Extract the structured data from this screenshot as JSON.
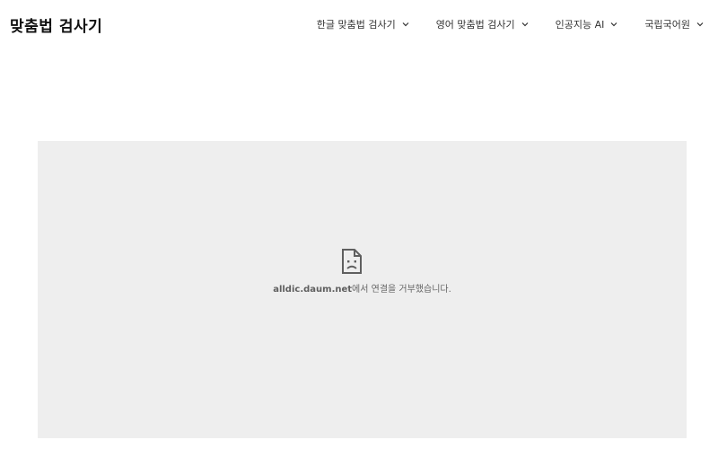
{
  "header": {
    "site_title": "맞춤법 검사기"
  },
  "nav": {
    "items": [
      {
        "label": "한글 맞춤법 검사기",
        "icon": "chevron-down-icon"
      },
      {
        "label": "영어 맞춤법 검사기",
        "icon": "chevron-down-icon"
      },
      {
        "label": "인공지능 AI",
        "icon": "chevron-down-icon"
      },
      {
        "label": "국립국어원",
        "icon": "chevron-down-icon"
      }
    ]
  },
  "embed": {
    "icon": "sad-document-icon",
    "host": "alldic.daum.net",
    "message": "에서 연결을 거부했습니다."
  },
  "colors": {
    "embed_background": "#eeeeee",
    "icon_stroke": "#5f5f5f"
  }
}
